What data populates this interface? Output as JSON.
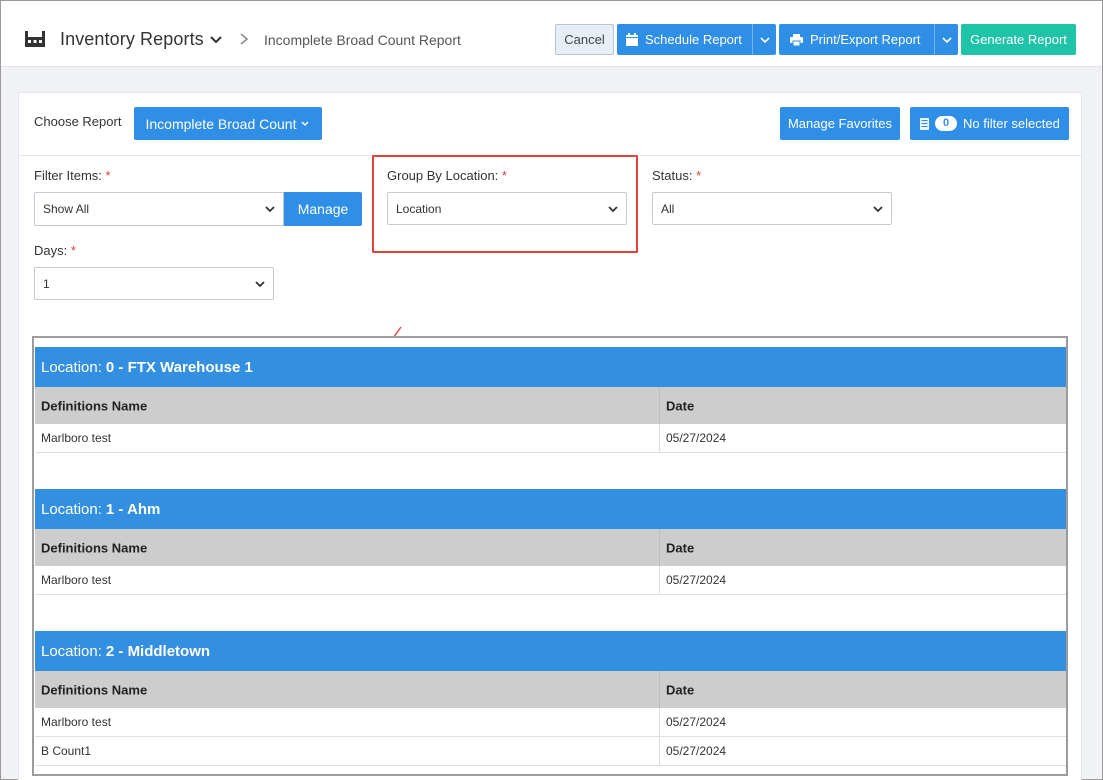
{
  "header": {
    "app_title": "Inventory Reports",
    "breadcrumb": "Incomplete Broad Count Report",
    "buttons": {
      "cancel": "Cancel",
      "schedule": "Schedule Report",
      "print_export": "Print/Export Report",
      "generate": "Generate Report"
    }
  },
  "toolbar": {
    "choose_label": "Choose Report",
    "report_selected": "Incomplete Broad Count",
    "manage_favorites": "Manage Favorites",
    "filter_count": "0",
    "filter_text": "No filter selected"
  },
  "filters": {
    "filter_items": {
      "label": "Filter Items:",
      "value": "Show All",
      "manage": "Manage"
    },
    "group_by": {
      "label": "Group By Location:",
      "value": "Location"
    },
    "status": {
      "label": "Status:",
      "value": "All"
    },
    "days": {
      "label": "Days:",
      "value": "1"
    },
    "required_mark": "*"
  },
  "report": {
    "location_prefix": "Location:",
    "columns": [
      "Definitions Name",
      "Date"
    ],
    "groups": [
      {
        "location": "0 - FTX Warehouse 1",
        "rows": [
          [
            "Marlboro test",
            "05/27/2024"
          ]
        ]
      },
      {
        "location": "1 - Ahm",
        "rows": [
          [
            "Marlboro test",
            "05/27/2024"
          ]
        ]
      },
      {
        "location": "2 - Middletown",
        "rows": [
          [
            "Marlboro test",
            "05/27/2024"
          ],
          [
            "B Count1",
            "05/27/2024"
          ]
        ]
      }
    ]
  },
  "colors": {
    "primary": "#2f8ee6",
    "success": "#1ec3a8",
    "group_header": "#338fe0",
    "highlight": "#e0443c",
    "required": "#e03b3b"
  },
  "icons": {
    "app": "warehouse-icon",
    "schedule": "calendar-icon",
    "print": "printer-icon",
    "filter": "filter-list-icon"
  }
}
